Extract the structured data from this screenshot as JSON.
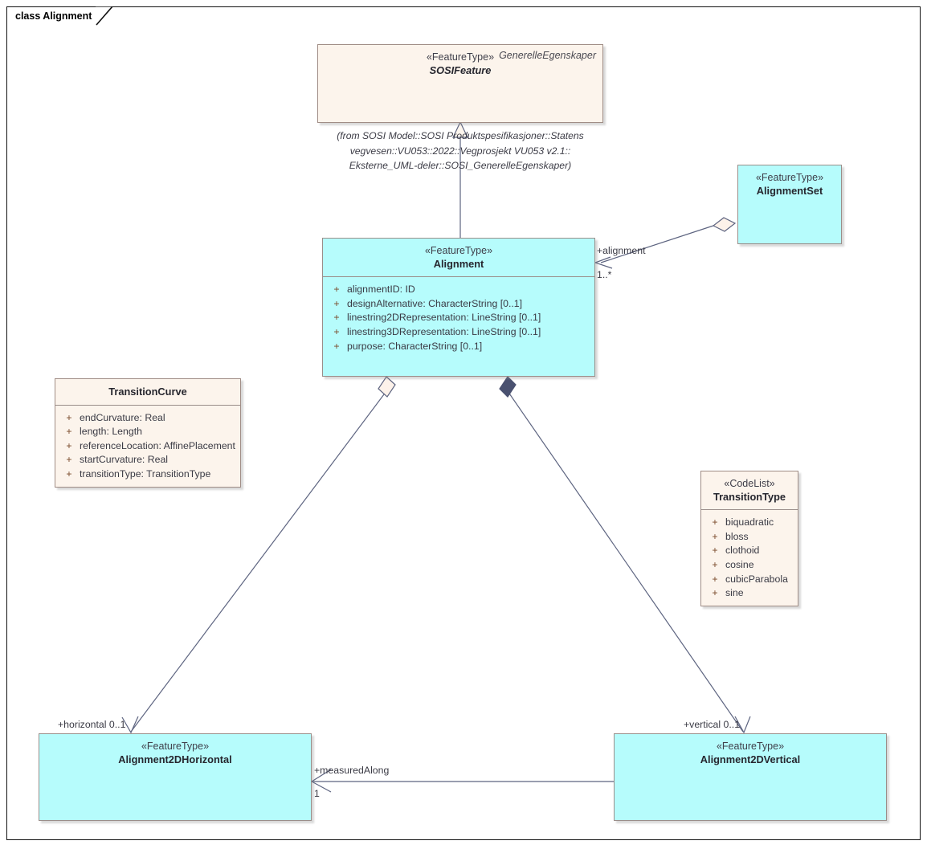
{
  "frame": {
    "tab_label": "class Alignment"
  },
  "classes": {
    "sosifeature": {
      "package": "GenerelleEgenskaper",
      "stereotype": "«FeatureType»",
      "name": "SOSIFeature"
    },
    "alignment": {
      "stereotype": "«FeatureType»",
      "name": "Alignment",
      "attributes": [
        {
          "visibility": "+",
          "text": "alignmentID: ID"
        },
        {
          "visibility": "+",
          "text": "designAlternative: CharacterString [0..1]"
        },
        {
          "visibility": "+",
          "text": "linestring2DRepresentation: LineString [0..1]"
        },
        {
          "visibility": "+",
          "text": "linestring3DRepresentation: LineString [0..1]"
        },
        {
          "visibility": "+",
          "text": "purpose: CharacterString [0..1]"
        }
      ]
    },
    "alignmentset": {
      "stereotype": "«FeatureType»",
      "name": "AlignmentSet"
    },
    "transitioncurve": {
      "name": "TransitionCurve",
      "attributes": [
        {
          "visibility": "+",
          "text": "endCurvature: Real"
        },
        {
          "visibility": "+",
          "text": "length: Length"
        },
        {
          "visibility": "+",
          "text": "referenceLocation: AffinePlacement"
        },
        {
          "visibility": "+",
          "text": "startCurvature: Real"
        },
        {
          "visibility": "+",
          "text": "transitionType: TransitionType"
        }
      ]
    },
    "transitiontype": {
      "stereotype": "«CodeList»",
      "name": "TransitionType",
      "attributes": [
        {
          "visibility": "+",
          "text": "biquadratic"
        },
        {
          "visibility": "+",
          "text": "bloss"
        },
        {
          "visibility": "+",
          "text": "clothoid"
        },
        {
          "visibility": "+",
          "text": "cosine"
        },
        {
          "visibility": "+",
          "text": "cubicParabola"
        },
        {
          "visibility": "+",
          "text": "sine"
        }
      ]
    },
    "alignment2dhorizontal": {
      "stereotype": "«FeatureType»",
      "name": "Alignment2DHorizontal"
    },
    "alignment2dvertical": {
      "stereotype": "«FeatureType»",
      "name": "Alignment2DVertical"
    }
  },
  "notes": {
    "sosifeature_origin": "(from SOSI Model::SOSI Produktspesifikasjoner::Statens\nvegvesen::VU053::2022::Vegprosjekt VU053 v2.1::\nEksterne_UML-deler::SOSI_GenerelleEgenskaper)"
  },
  "edge_labels": {
    "alignment_role": "+alignment",
    "alignment_multiplicity": "1..*",
    "horizontal_role": "+horizontal 0..1",
    "vertical_role": "+vertical 0..1",
    "measuredalong_role": "+measuredAlong",
    "measuredalong_multiplicity": "1"
  },
  "colors": {
    "featuretype_fill": "#b6fcfc",
    "codelist_fill": "#fcf4ec",
    "box_border": "#9a8e8a",
    "connector_line": "#5d6480",
    "frame_border": "#111111"
  }
}
